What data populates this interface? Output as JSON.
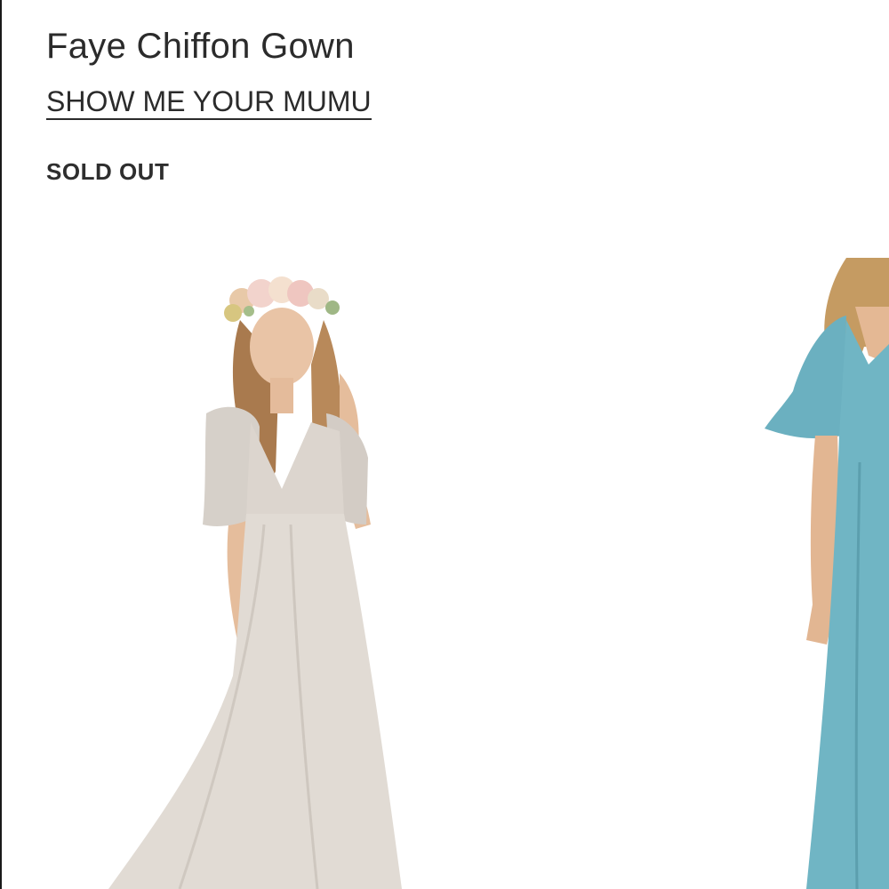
{
  "product": {
    "title": "Faye Chiffon Gown",
    "brand": "SHOW ME YOUR MUMU",
    "status": "SOLD OUT"
  },
  "gallery": {
    "images": [
      {
        "name": "main-image",
        "dress_color": "#d9d3cc"
      },
      {
        "name": "next-image",
        "dress_color": "#6fb3c2"
      }
    ]
  },
  "colors": {
    "text": "#2b2b2b",
    "background": "#ffffff"
  }
}
